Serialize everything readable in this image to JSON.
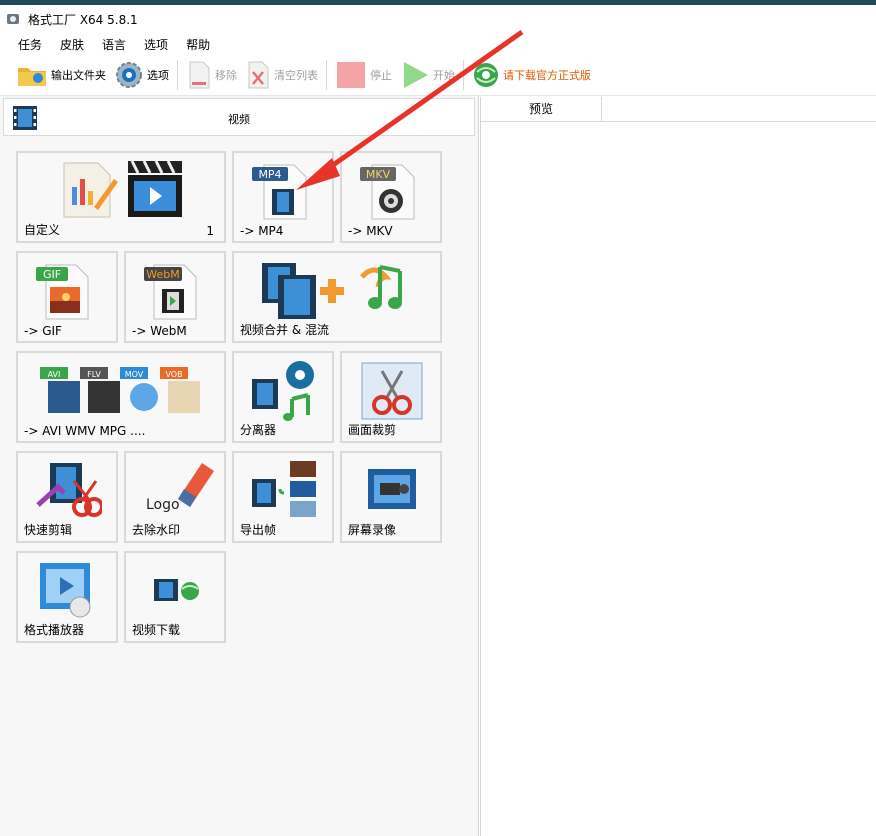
{
  "window": {
    "title": "格式工厂 X64 5.8.1"
  },
  "menu": [
    "任务",
    "皮肤",
    "语言",
    "选项",
    "帮助"
  ],
  "toolbar": {
    "output_folder": "输出文件夹",
    "options": "选项",
    "remove": "移除",
    "clear_list": "清空列表",
    "stop": "停止",
    "start": "开始",
    "download": "请下载官方正式版"
  },
  "category": {
    "label": "视频"
  },
  "preview": {
    "header": "预览"
  },
  "tiles": {
    "custom": {
      "label": "自定义",
      "count": "1"
    },
    "mp4": {
      "label": "-> MP4",
      "badge": "MP4"
    },
    "mkv": {
      "label": "-> MKV",
      "badge": "MKV"
    },
    "gif": {
      "label": "-> GIF",
      "badge": "GIF"
    },
    "webm": {
      "label": "-> WebM",
      "badge": "WebM"
    },
    "merge": {
      "label": "视频合并 & 混流"
    },
    "multi": {
      "label": "-> AVI WMV MPG ....",
      "badges": [
        "AVI",
        "FLV",
        "MOV",
        "VOB"
      ]
    },
    "separator": {
      "label": "分离器"
    },
    "crop": {
      "label": "画面裁剪"
    },
    "quickcut": {
      "label": "快速剪辑"
    },
    "watermark": {
      "label": "去除水印",
      "logo_text": "Logo"
    },
    "frames": {
      "label": "导出帧"
    },
    "screenrec": {
      "label": "屏幕录像"
    },
    "player": {
      "label": "格式播放器"
    },
    "videodl": {
      "label": "视频下载"
    }
  },
  "colors": {
    "accent_arrow": "#e8332a",
    "download_text": "#e05a00",
    "title_strip": "#1f4a5a"
  }
}
